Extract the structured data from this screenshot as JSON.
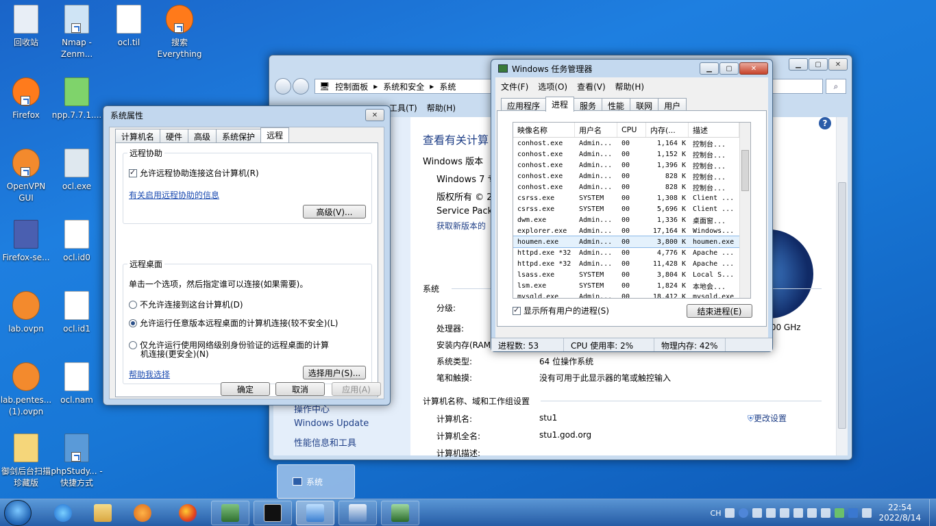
{
  "desktop": {
    "icons": [
      {
        "label": "回收站"
      },
      {
        "label": "Nmap - Zenm..."
      },
      {
        "label": "ocl.til"
      },
      {
        "label": "搜索 Everything"
      },
      {
        "label": "Firefox"
      },
      {
        "label": "npp.7.7.1...."
      },
      {
        "label": "OpenVPN GUI"
      },
      {
        "label": "ocl.exe"
      },
      {
        "label": "Firefox-se..."
      },
      {
        "label": "ocl.id0"
      },
      {
        "label": "lab.ovpn"
      },
      {
        "label": "ocl.id1"
      },
      {
        "label": "lab.pentes... (1).ovpn"
      },
      {
        "label": "ocl.nam"
      },
      {
        "label": "御剑后台扫描珍藏版"
      },
      {
        "label": "phpStudy... - 快捷方式"
      }
    ]
  },
  "control_panel": {
    "breadcrumb": [
      "控制面板",
      "系统和安全",
      "系统"
    ],
    "menu": [
      "工具(T)",
      "帮助(H)"
    ],
    "heading": "查看有关计算",
    "edition_label": "Windows 版本",
    "edition_value": "Windows 7 专",
    "copyright": "版权所有 © 2",
    "service_pack": "Service Pack",
    "get_new_version": "获取新版本的",
    "system_section": "系统",
    "rating_label": "分级:",
    "cpu_label": "处理器:",
    "cpu_value_tail": ".00 GHz",
    "ram_label": "安装内存(RAM",
    "systype_label": "系统类型:",
    "systype_value": "64 位操作系统",
    "pen_label": "笔和触摸:",
    "pen_value": "没有可用于此显示器的笔或触控输入",
    "computer_section": "计算机名称、域和工作组设置",
    "cname_label": "计算机名:",
    "cname_value": "stu1",
    "fullname_label": "计算机全名:",
    "fullname_value": "stu1.god.org",
    "desc_label": "计算机描述:",
    "change_settings": "更改设置",
    "side_links": [
      "操作中心",
      "Windows Update",
      "性能信息和工具"
    ]
  },
  "system_properties": {
    "title": "系统属性",
    "tabs": [
      "计算机名",
      "硬件",
      "高级",
      "系统保护",
      "远程"
    ],
    "active_tab": "远程",
    "assist_group": "远程协助",
    "assist_checkbox": "允许远程协助连接这台计算机(R)",
    "assist_link": "有关启用远程协助的信息",
    "advanced_btn": "高级(V)...",
    "desktop_group": "远程桌面",
    "desktop_hint": "单击一个选项，然后指定谁可以连接(如果需要)。",
    "radio1": "不允许连接到这台计算机(D)",
    "radio2": "允许运行任意版本远程桌面的计算机连接(较不安全)(L)",
    "radio3_line1": "仅允许运行使用网络级别身份验证的远程桌面的计算",
    "radio3_line2": "机连接(更安全)(N)",
    "help_link": "帮助我选择",
    "select_users_btn": "选择用户(S)...",
    "ok": "确定",
    "cancel": "取消",
    "apply": "应用(A)"
  },
  "task_manager": {
    "title": "Windows 任务管理器",
    "menu": [
      "文件(F)",
      "选项(O)",
      "查看(V)",
      "帮助(H)"
    ],
    "tabs": [
      "应用程序",
      "进程",
      "服务",
      "性能",
      "联网",
      "用户"
    ],
    "active_tab": "进程",
    "columns": [
      "映像名称",
      "用户名",
      "CPU",
      "内存(...",
      "描述"
    ],
    "rows": [
      [
        "conhost.exe",
        "Admin...",
        "00",
        "1,164 K",
        "控制台..."
      ],
      [
        "conhost.exe",
        "Admin...",
        "00",
        "1,152 K",
        "控制台..."
      ],
      [
        "conhost.exe",
        "Admin...",
        "00",
        "1,396 K",
        "控制台..."
      ],
      [
        "conhost.exe",
        "Admin...",
        "00",
        "828 K",
        "控制台..."
      ],
      [
        "conhost.exe",
        "Admin...",
        "00",
        "828 K",
        "控制台..."
      ],
      [
        "csrss.exe",
        "SYSTEM",
        "00",
        "1,308 K",
        "Client ..."
      ],
      [
        "csrss.exe",
        "SYSTEM",
        "00",
        "5,696 K",
        "Client ..."
      ],
      [
        "dwm.exe",
        "Admin...",
        "00",
        "1,336 K",
        "桌面窗..."
      ],
      [
        "explorer.exe",
        "Admin...",
        "00",
        "17,164 K",
        "Windows..."
      ],
      [
        "houmen.exe",
        "Admin...",
        "00",
        "3,800 K",
        "houmen.exe"
      ],
      [
        "httpd.exe *32",
        "Admin...",
        "00",
        "4,776 K",
        "Apache ..."
      ],
      [
        "httpd.exe *32",
        "Admin...",
        "00",
        "11,428 K",
        "Apache ..."
      ],
      [
        "lsass.exe",
        "SYSTEM",
        "00",
        "3,804 K",
        "Local S..."
      ],
      [
        "lsm.exe",
        "SYSTEM",
        "00",
        "1,824 K",
        "本地会..."
      ],
      [
        "mysqld.exe",
        "Admin...",
        "00",
        "18,412 K",
        "mysqld.exe"
      ]
    ],
    "selected_row": 9,
    "show_all_checkbox": "显示所有用户的进程(S)",
    "end_process_btn": "结束进程(E)",
    "status_processes": "进程数: 53",
    "status_cpu": "CPU 使用率: 2%",
    "status_mem": "物理内存: 42%"
  },
  "taskbar": {
    "popup_label": "系统",
    "lang": "CH",
    "time": "22:54",
    "date": "2022/8/14"
  }
}
